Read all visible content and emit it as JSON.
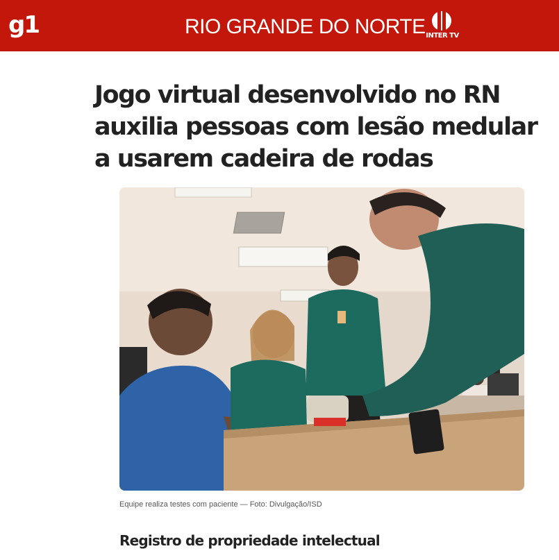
{
  "header": {
    "logo_text": "g1",
    "region": "RIO GRANDE DO NORTE",
    "affiliate": "INTER TV",
    "background_color": "#c4170c"
  },
  "article": {
    "headline": "Jogo virtual desenvolvido no RN auxilia pessoas com lesão medular a usarem cadeira de rodas",
    "photo_caption": "Equipe realiza testes com paciente — Foto: Divulgação/ISD",
    "subheading": "Registro de propriedade intelectual"
  }
}
